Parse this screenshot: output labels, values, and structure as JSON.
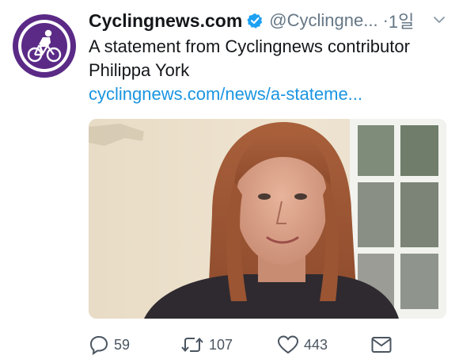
{
  "account": {
    "display_name": "Cyclingnews.com",
    "handle": "@Cyclingne...",
    "time": "1일",
    "verified": true,
    "avatar_icon": "cyclist-logo"
  },
  "tweet": {
    "text": "A statement from Cyclingnews contributor Philippa York",
    "link": "cyclingnews.com/news/a-stateme..."
  },
  "actions": {
    "reply_count": "59",
    "retweet_count": "107",
    "like_count": "443"
  },
  "colors": {
    "brand_purple": "#5b2a86",
    "link_blue": "#1b95e0",
    "verified_blue": "#1da1f2",
    "muted_gray": "#657786"
  }
}
